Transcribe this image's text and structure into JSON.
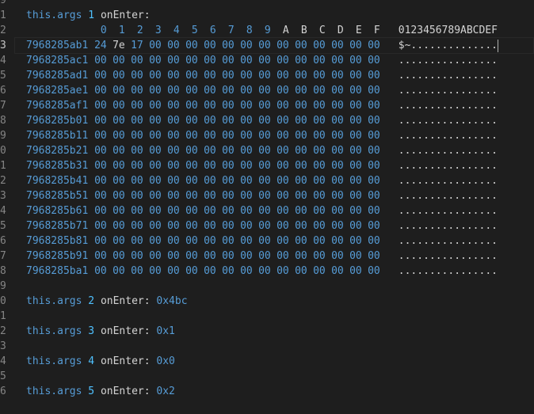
{
  "gutter": [
    "9",
    "1",
    "2",
    "3",
    "4",
    "5",
    "6",
    "7",
    "8",
    "9",
    "0",
    "1",
    "2",
    "3",
    "4",
    "5",
    "6",
    "7",
    "8",
    "9",
    "0",
    "1",
    "2",
    "3",
    "4",
    "5",
    "6"
  ],
  "args1": {
    "this": "this.args",
    "num": "1",
    "label": "onEnter:"
  },
  "header": {
    "hex_cols": [
      "0",
      "1",
      "2",
      "3",
      "4",
      "5",
      "6",
      "7",
      "8",
      "9",
      "A",
      "B",
      "C",
      "D",
      "E",
      "F"
    ],
    "ascii_header": "0123456789ABCDEF"
  },
  "rows": [
    {
      "offset": "7968285ab1",
      "bytes": [
        "24",
        "7e",
        "17",
        "00",
        "00",
        "00",
        "00",
        "00",
        "00",
        "00",
        "00",
        "00",
        "00",
        "00",
        "00",
        "00"
      ],
      "ascii": "$~.............."
    },
    {
      "offset": "7968285ac1",
      "bytes": [
        "00",
        "00",
        "00",
        "00",
        "00",
        "00",
        "00",
        "00",
        "00",
        "00",
        "00",
        "00",
        "00",
        "00",
        "00",
        "00"
      ],
      "ascii": "................"
    },
    {
      "offset": "7968285ad1",
      "bytes": [
        "00",
        "00",
        "00",
        "00",
        "00",
        "00",
        "00",
        "00",
        "00",
        "00",
        "00",
        "00",
        "00",
        "00",
        "00",
        "00"
      ],
      "ascii": "................"
    },
    {
      "offset": "7968285ae1",
      "bytes": [
        "00",
        "00",
        "00",
        "00",
        "00",
        "00",
        "00",
        "00",
        "00",
        "00",
        "00",
        "00",
        "00",
        "00",
        "00",
        "00"
      ],
      "ascii": "................"
    },
    {
      "offset": "7968285af1",
      "bytes": [
        "00",
        "00",
        "00",
        "00",
        "00",
        "00",
        "00",
        "00",
        "00",
        "00",
        "00",
        "00",
        "00",
        "00",
        "00",
        "00"
      ],
      "ascii": "................"
    },
    {
      "offset": "7968285b01",
      "bytes": [
        "00",
        "00",
        "00",
        "00",
        "00",
        "00",
        "00",
        "00",
        "00",
        "00",
        "00",
        "00",
        "00",
        "00",
        "00",
        "00"
      ],
      "ascii": "................"
    },
    {
      "offset": "7968285b11",
      "bytes": [
        "00",
        "00",
        "00",
        "00",
        "00",
        "00",
        "00",
        "00",
        "00",
        "00",
        "00",
        "00",
        "00",
        "00",
        "00",
        "00"
      ],
      "ascii": "................"
    },
    {
      "offset": "7968285b21",
      "bytes": [
        "00",
        "00",
        "00",
        "00",
        "00",
        "00",
        "00",
        "00",
        "00",
        "00",
        "00",
        "00",
        "00",
        "00",
        "00",
        "00"
      ],
      "ascii": "................"
    },
    {
      "offset": "7968285b31",
      "bytes": [
        "00",
        "00",
        "00",
        "00",
        "00",
        "00",
        "00",
        "00",
        "00",
        "00",
        "00",
        "00",
        "00",
        "00",
        "00",
        "00"
      ],
      "ascii": "................"
    },
    {
      "offset": "7968285b41",
      "bytes": [
        "00",
        "00",
        "00",
        "00",
        "00",
        "00",
        "00",
        "00",
        "00",
        "00",
        "00",
        "00",
        "00",
        "00",
        "00",
        "00"
      ],
      "ascii": "................"
    },
    {
      "offset": "7968285b51",
      "bytes": [
        "00",
        "00",
        "00",
        "00",
        "00",
        "00",
        "00",
        "00",
        "00",
        "00",
        "00",
        "00",
        "00",
        "00",
        "00",
        "00"
      ],
      "ascii": "................"
    },
    {
      "offset": "7968285b61",
      "bytes": [
        "00",
        "00",
        "00",
        "00",
        "00",
        "00",
        "00",
        "00",
        "00",
        "00",
        "00",
        "00",
        "00",
        "00",
        "00",
        "00"
      ],
      "ascii": "................"
    },
    {
      "offset": "7968285b71",
      "bytes": [
        "00",
        "00",
        "00",
        "00",
        "00",
        "00",
        "00",
        "00",
        "00",
        "00",
        "00",
        "00",
        "00",
        "00",
        "00",
        "00"
      ],
      "ascii": "................"
    },
    {
      "offset": "7968285b81",
      "bytes": [
        "00",
        "00",
        "00",
        "00",
        "00",
        "00",
        "00",
        "00",
        "00",
        "00",
        "00",
        "00",
        "00",
        "00",
        "00",
        "00"
      ],
      "ascii": "................"
    },
    {
      "offset": "7968285b91",
      "bytes": [
        "00",
        "00",
        "00",
        "00",
        "00",
        "00",
        "00",
        "00",
        "00",
        "00",
        "00",
        "00",
        "00",
        "00",
        "00",
        "00"
      ],
      "ascii": "................"
    },
    {
      "offset": "7968285ba1",
      "bytes": [
        "00",
        "00",
        "00",
        "00",
        "00",
        "00",
        "00",
        "00",
        "00",
        "00",
        "00",
        "00",
        "00",
        "00",
        "00",
        "00"
      ],
      "ascii": "................"
    }
  ],
  "args2": {
    "this": "this.args",
    "num": "2",
    "label": "onEnter:",
    "value": "0x4bc"
  },
  "args3": {
    "this": "this.args",
    "num": "3",
    "label": "onEnter:",
    "value": "0x1"
  },
  "args4": {
    "this": "this.args",
    "num": "4",
    "label": "onEnter:",
    "value": "0x0"
  },
  "args5": {
    "this": "this.args",
    "num": "5",
    "label": "onEnter:",
    "value": "0x2"
  },
  "colors": {
    "background": "#1e1e1e",
    "keyword": "#569cd6",
    "text": "#d4d4d4",
    "gutter": "#858585"
  }
}
